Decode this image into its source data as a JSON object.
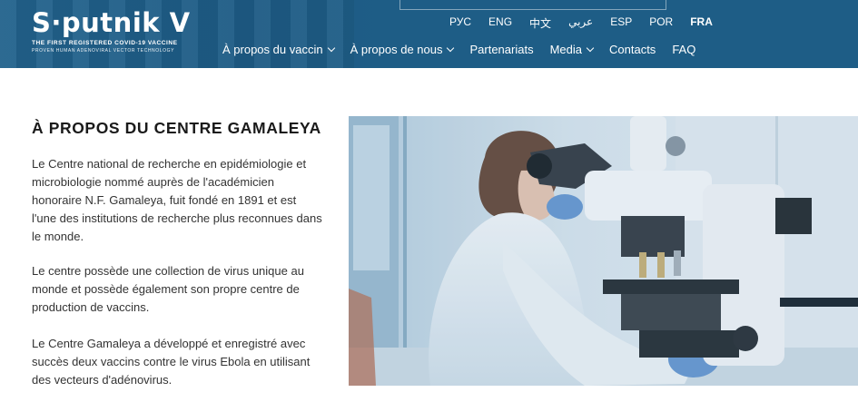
{
  "brand": {
    "logo_text": "S·putnik V",
    "tagline_1": "THE FIRST REGISTERED COVID-19 VACCINE",
    "tagline_2": "PROVEN HUMAN ADENOVIRAL VECTOR TECHNOLOGY"
  },
  "languages": [
    {
      "label": "РУС",
      "active": false
    },
    {
      "label": "ENG",
      "active": false
    },
    {
      "label": "中文",
      "active": false
    },
    {
      "label": "عربي",
      "active": false
    },
    {
      "label": "ESP",
      "active": false
    },
    {
      "label": "POR",
      "active": false
    },
    {
      "label": "FRA",
      "active": true
    }
  ],
  "nav": [
    {
      "label": "À propos du vaccin",
      "dropdown": true
    },
    {
      "label": "À propos de nous",
      "dropdown": true
    },
    {
      "label": "Partenariats",
      "dropdown": false
    },
    {
      "label": "Media",
      "dropdown": true
    },
    {
      "label": "Contacts",
      "dropdown": false
    },
    {
      "label": "FAQ",
      "dropdown": false
    }
  ],
  "main": {
    "heading": "À PROPOS DU CENTRE GAMALEYA",
    "paragraphs": [
      "Le Centre national de recherche en epidémiologie et microbiologie nommé auprès de l'académicien honoraire N.F. Gamaleya, fuit fondé en 1891 et est l'une des institutions de recherche plus reconnues dans le monde.",
      "Le centre possède une collection de virus unique au monde et possède également son propre centre de production de vaccins.",
      "Le Centre Gamaleya a développé et enregistré avec succès deux vaccins contre le virus Ebola en utilisant des vecteurs d'adénovirus."
    ],
    "photo_icon": "laboratory-scientist-microscope-photo"
  },
  "colors": {
    "header_bg": "#1e5d86",
    "text": "#333333",
    "heading": "#1a1a1a"
  }
}
